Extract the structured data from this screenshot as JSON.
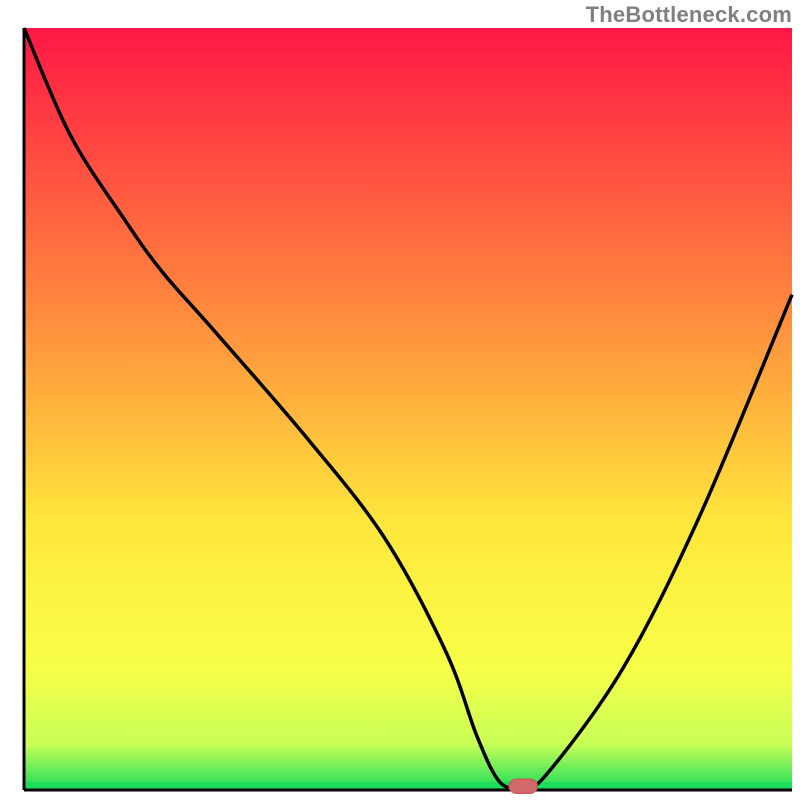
{
  "watermark": {
    "text": "TheBottleneck.com"
  },
  "colors": {
    "curve": "#000000",
    "axis": "#000000",
    "bottom_line": "#1bdc5b",
    "marker_fill": "#d36a6a",
    "marker_stroke": "#ca5b5b",
    "grad_top": "#ff1745",
    "grad_upper_mid": "#ff833e",
    "grad_mid": "#ffe73c",
    "grad_lower_mid": "#f8ff48",
    "grad_near_bottom": "#c8ff57",
    "grad_bottom": "#1bdc5b"
  },
  "chart_data": {
    "type": "line",
    "title": "",
    "xlabel": "",
    "ylabel": "",
    "xlim": [
      0,
      100
    ],
    "ylim": [
      0,
      100
    ],
    "x": [
      0,
      6,
      13,
      18,
      25,
      37,
      47,
      55,
      59,
      62,
      65,
      68,
      78,
      88,
      100
    ],
    "values": [
      100,
      86,
      75,
      68,
      60,
      46,
      33,
      18,
      7,
      1,
      0.5,
      2,
      16,
      36,
      65
    ],
    "marker": {
      "x": 65,
      "y": 0.5
    }
  }
}
